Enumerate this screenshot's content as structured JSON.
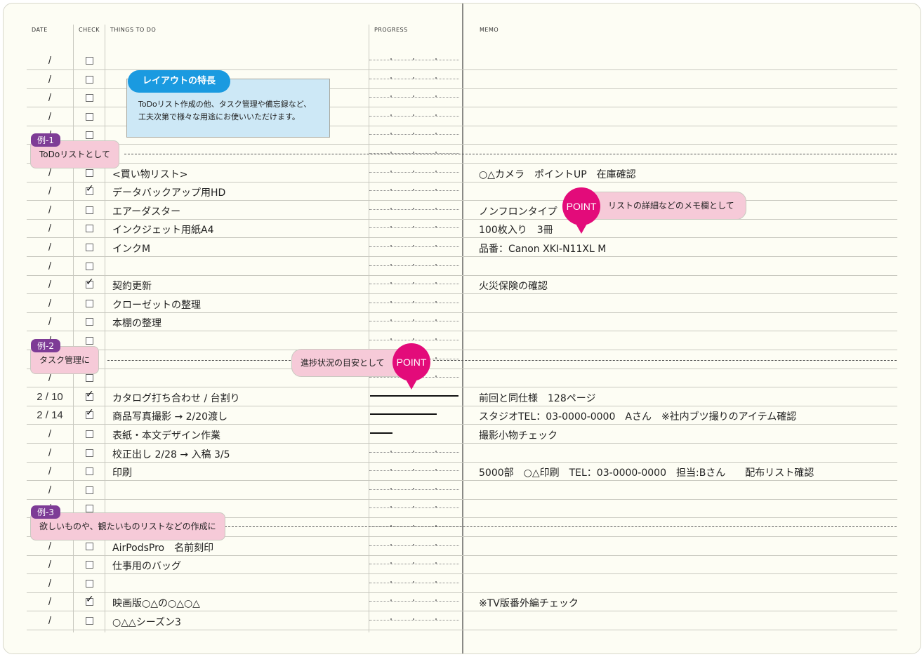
{
  "headers": {
    "date": "DATE",
    "check": "CHECK",
    "things": "THINGS TO DO",
    "progress": "PROGRESS",
    "memo": "MEMO"
  },
  "feature_box": {
    "title": "レイアウトの特長",
    "line1": "ToDoリスト作成の他、タスク管理や備忘録など、",
    "line2": "工夫次第で様々な用途にお使いいただけます。"
  },
  "examples": [
    {
      "tag": "例-1",
      "label": "ToDoリストとして"
    },
    {
      "tag": "例-2",
      "label": "タスク管理に"
    },
    {
      "tag": "例-3",
      "label": "欲しいものや、観たいものリストなどの作成に"
    }
  ],
  "points": [
    {
      "badge": "POINT",
      "text": "リストの詳細などのメモ欄として"
    },
    {
      "badge": "POINT",
      "text": "進捗状況の目安として"
    }
  ],
  "rows": [
    {
      "date": "/",
      "checked": false,
      "task": "",
      "memo": "",
      "progress": null
    },
    {
      "date": "/",
      "checked": false,
      "task": "",
      "memo": "",
      "progress": null
    },
    {
      "date": "/",
      "checked": false,
      "task": "",
      "memo": "",
      "progress": null
    },
    {
      "date": "/",
      "checked": false,
      "task": "",
      "memo": "",
      "progress": null
    },
    {
      "date": "/",
      "checked": false,
      "task": "",
      "memo": "",
      "progress": null
    },
    {
      "date": "/",
      "checked": false,
      "task": "",
      "memo": "",
      "progress": null
    },
    {
      "date": "/",
      "checked": false,
      "task": "<買い物リスト>",
      "memo": "○△カメラ　ポイントUP　在庫確認",
      "progress": null
    },
    {
      "date": "/",
      "checked": true,
      "task": "データバックアップ用HD",
      "memo": "",
      "progress": null
    },
    {
      "date": "/",
      "checked": false,
      "task": "エアーダスター",
      "memo": "ノンフロンタイプ",
      "progress": null
    },
    {
      "date": "/",
      "checked": false,
      "task": "インクジェット用紙A4",
      "memo": "100枚入り　3冊",
      "progress": null
    },
    {
      "date": "/",
      "checked": false,
      "task": "インクM",
      "memo": "品番：Canon XKI-N11XL M",
      "progress": null
    },
    {
      "date": "/",
      "checked": false,
      "task": "",
      "memo": "",
      "progress": null
    },
    {
      "date": "/",
      "checked": true,
      "task": "契約更新",
      "memo": "火災保険の確認",
      "progress": null
    },
    {
      "date": "/",
      "checked": false,
      "task": "クローゼットの整理",
      "memo": "",
      "progress": null
    },
    {
      "date": "/",
      "checked": false,
      "task": "本棚の整理",
      "memo": "",
      "progress": null
    },
    {
      "date": "/",
      "checked": false,
      "task": "",
      "memo": "",
      "progress": null
    },
    {
      "date": "/",
      "checked": false,
      "task": "",
      "memo": "",
      "progress": null
    },
    {
      "date": "/",
      "checked": false,
      "task": "",
      "memo": "",
      "progress": null
    },
    {
      "date": "2 / 10",
      "checked": true,
      "task": "カタログ打ち合わせ / 台割り",
      "memo": "前回と同仕様　128ページ",
      "progress": 1.0
    },
    {
      "date": "2 / 14",
      "checked": true,
      "task": "商品写真撮影 → 2/20渡し",
      "memo": "スタジオTEL：03-0000-0000　Aさん　※社内ブツ撮りのアイテム確認",
      "progress": 0.75
    },
    {
      "date": "/",
      "checked": false,
      "task": "表紙・本文デザイン作業",
      "memo": "撮影小物チェック",
      "progress": 0.25
    },
    {
      "date": "/",
      "checked": false,
      "task": "校正出し 2/28 → 入稿 3/5",
      "memo": "",
      "progress": null
    },
    {
      "date": "/",
      "checked": false,
      "task": "印刷",
      "memo": "5000部　○△印刷　TEL：03-0000-0000　担当:Bさん　　配布リスト確認",
      "progress": null
    },
    {
      "date": "/",
      "checked": false,
      "task": "",
      "memo": "",
      "progress": null
    },
    {
      "date": "/",
      "checked": false,
      "task": "",
      "memo": "",
      "progress": null
    },
    {
      "date": "/",
      "checked": false,
      "task": "",
      "memo": "",
      "progress": null
    },
    {
      "date": "/",
      "checked": false,
      "task": "AirPodsPro　名前刻印",
      "memo": "",
      "progress": null
    },
    {
      "date": "/",
      "checked": false,
      "task": "仕事用のバッグ",
      "memo": "",
      "progress": null
    },
    {
      "date": "/",
      "checked": false,
      "task": "",
      "memo": "",
      "progress": null
    },
    {
      "date": "/",
      "checked": true,
      "task": "映画版○△の○△○△",
      "memo": "※TV版番外編チェック",
      "progress": null
    },
    {
      "date": "/",
      "checked": false,
      "task": "○△△シーズン3",
      "memo": "",
      "progress": null
    }
  ],
  "check_mark": "✓"
}
